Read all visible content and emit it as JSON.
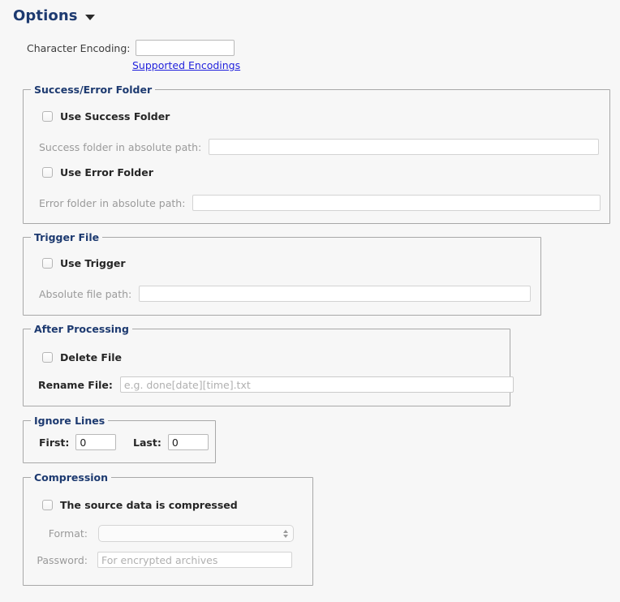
{
  "header": {
    "title": "Options",
    "disclosure_icon": "chevron-down-icon"
  },
  "character_encoding": {
    "label": "Character Encoding:",
    "value": "",
    "placeholder": "",
    "link_label": "Supported Encodings"
  },
  "success_error_folder": {
    "legend": "Success/Error Folder",
    "use_success_checkbox": {
      "label": "Use Success Folder",
      "checked": false
    },
    "success_path": {
      "label": "Success folder in absolute path:",
      "value": "",
      "placeholder": "",
      "enabled": false
    },
    "use_error_checkbox": {
      "label": "Use Error Folder",
      "checked": false
    },
    "error_path": {
      "label": "Error folder in absolute path:",
      "value": "",
      "placeholder": "",
      "enabled": false
    }
  },
  "trigger_file": {
    "legend": "Trigger File",
    "use_trigger_checkbox": {
      "label": "Use Trigger",
      "checked": false
    },
    "file_path": {
      "label": "Absolute file path:",
      "value": "",
      "placeholder": "",
      "enabled": false
    }
  },
  "after_processing": {
    "legend": "After Processing",
    "delete_file_checkbox": {
      "label": "Delete File",
      "checked": false
    },
    "rename_file": {
      "label": "Rename File:",
      "value": "",
      "placeholder": "e.g. done[date][time].txt",
      "enabled": true
    }
  },
  "ignore_lines": {
    "legend": "Ignore Lines",
    "first": {
      "label": "First:",
      "value": "0"
    },
    "last": {
      "label": "Last:",
      "value": "0"
    }
  },
  "compression": {
    "legend": "Compression",
    "compressed_checkbox": {
      "label": "The source data is compressed",
      "checked": false
    },
    "format": {
      "label": "Format:",
      "selected": "",
      "enabled": false,
      "stepper_icon": "chevron-up-down-icon"
    },
    "password": {
      "label": "Password:",
      "value": "",
      "placeholder": "For encrypted archives",
      "enabled": false
    }
  },
  "colors": {
    "background": "#f7f7f7",
    "legend_navy": "#1d3a70",
    "link_blue": "#2222dd",
    "disabled_gray": "#9a9a9a",
    "fieldset_border": "#a8a8a8"
  }
}
